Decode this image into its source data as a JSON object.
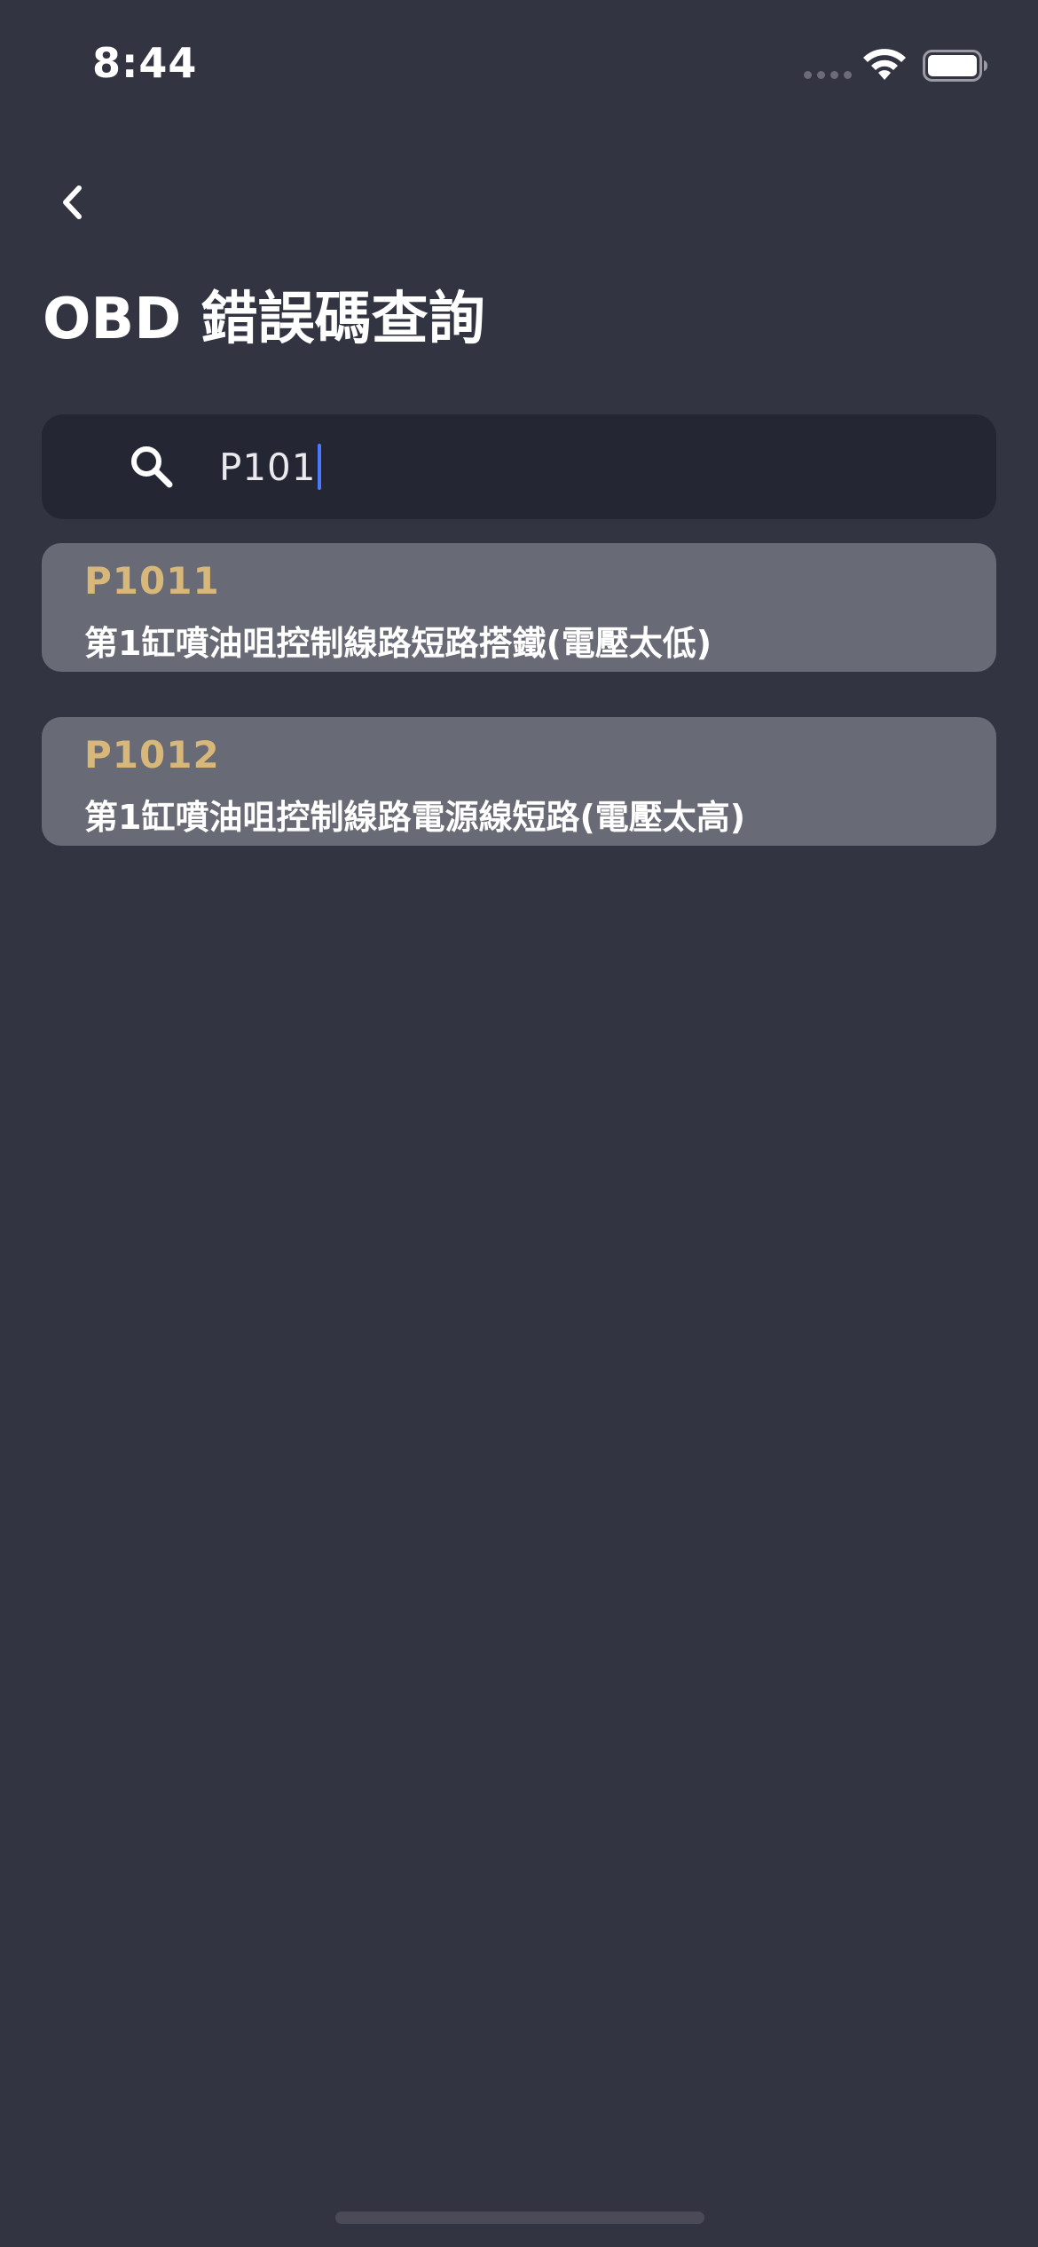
{
  "status_bar": {
    "time": "8:44"
  },
  "header": {
    "title": "OBD 錯誤碼查詢"
  },
  "search": {
    "value": "P101"
  },
  "results": [
    {
      "code": "P1011",
      "description": "第1缸噴油咀控制線路短路搭鐵(電壓太低)"
    },
    {
      "code": "P1012",
      "description": "第1缸噴油咀控制線路電源線短路(電壓太高)"
    }
  ],
  "colors": {
    "background": "#333441",
    "search_background": "#242633",
    "card_background": "#686a75",
    "code_accent": "#d8b77b",
    "caret": "#4a78ff"
  },
  "icons": {
    "back": "chevron-left-icon",
    "search": "search-icon",
    "wifi": "wifi-icon",
    "battery": "battery-icon"
  }
}
